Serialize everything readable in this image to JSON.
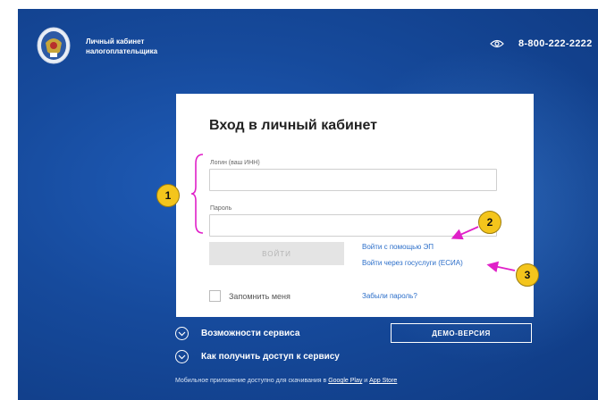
{
  "header": {
    "brand_line1": "Личный кабинет",
    "brand_line2": "налогоплательщика",
    "phone": "8-800-222-2222"
  },
  "login_card": {
    "title": "Вход в личный кабинет",
    "login_label": "Логин (ваш ИНН)",
    "login_value": "",
    "password_label": "Пароль",
    "password_value": "",
    "submit_label": "ВОЙТИ",
    "link_ep": "Войти с помощью ЭП",
    "link_esia": "Войти через госуслуги (ЕСИА)",
    "remember_label": "Запомнить меня",
    "forgot_link": "Забыли пароль?"
  },
  "features": {
    "service_capabilities": "Возможности сервиса",
    "get_access": "Как получить доступ к сервису",
    "demo_label": "ДЕМО-ВЕРСИЯ"
  },
  "footer": {
    "mobile_text": "Мобильное приложение доступно для скачивания в",
    "google_play": "Google Play",
    "and": "и",
    "app_store": "App Store"
  },
  "annotations": {
    "badge1": "1",
    "badge2": "2",
    "badge3": "3"
  },
  "colors": {
    "background": "#164a9c",
    "link": "#2b6ec9",
    "annotation_arrow": "#e020c8",
    "badge": "#f4c51c"
  }
}
